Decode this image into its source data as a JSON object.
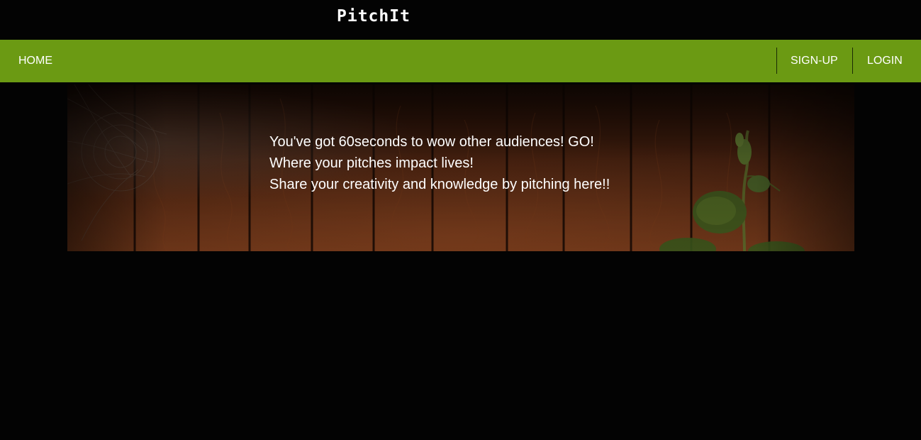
{
  "brand": {
    "title": "PitchIt"
  },
  "nav": {
    "home": "HOME",
    "signup": "SIGN-UP",
    "login": "LOGIN"
  },
  "hero": {
    "lines": [
      "You've got 60seconds to wow other audiences! GO!",
      "Where your pitches impact lives!",
      "Share your creativity and knowledge by pitching here!!"
    ]
  },
  "colors": {
    "background": "#030303",
    "navbar": "#6b9a13",
    "text": "#ffffff"
  }
}
